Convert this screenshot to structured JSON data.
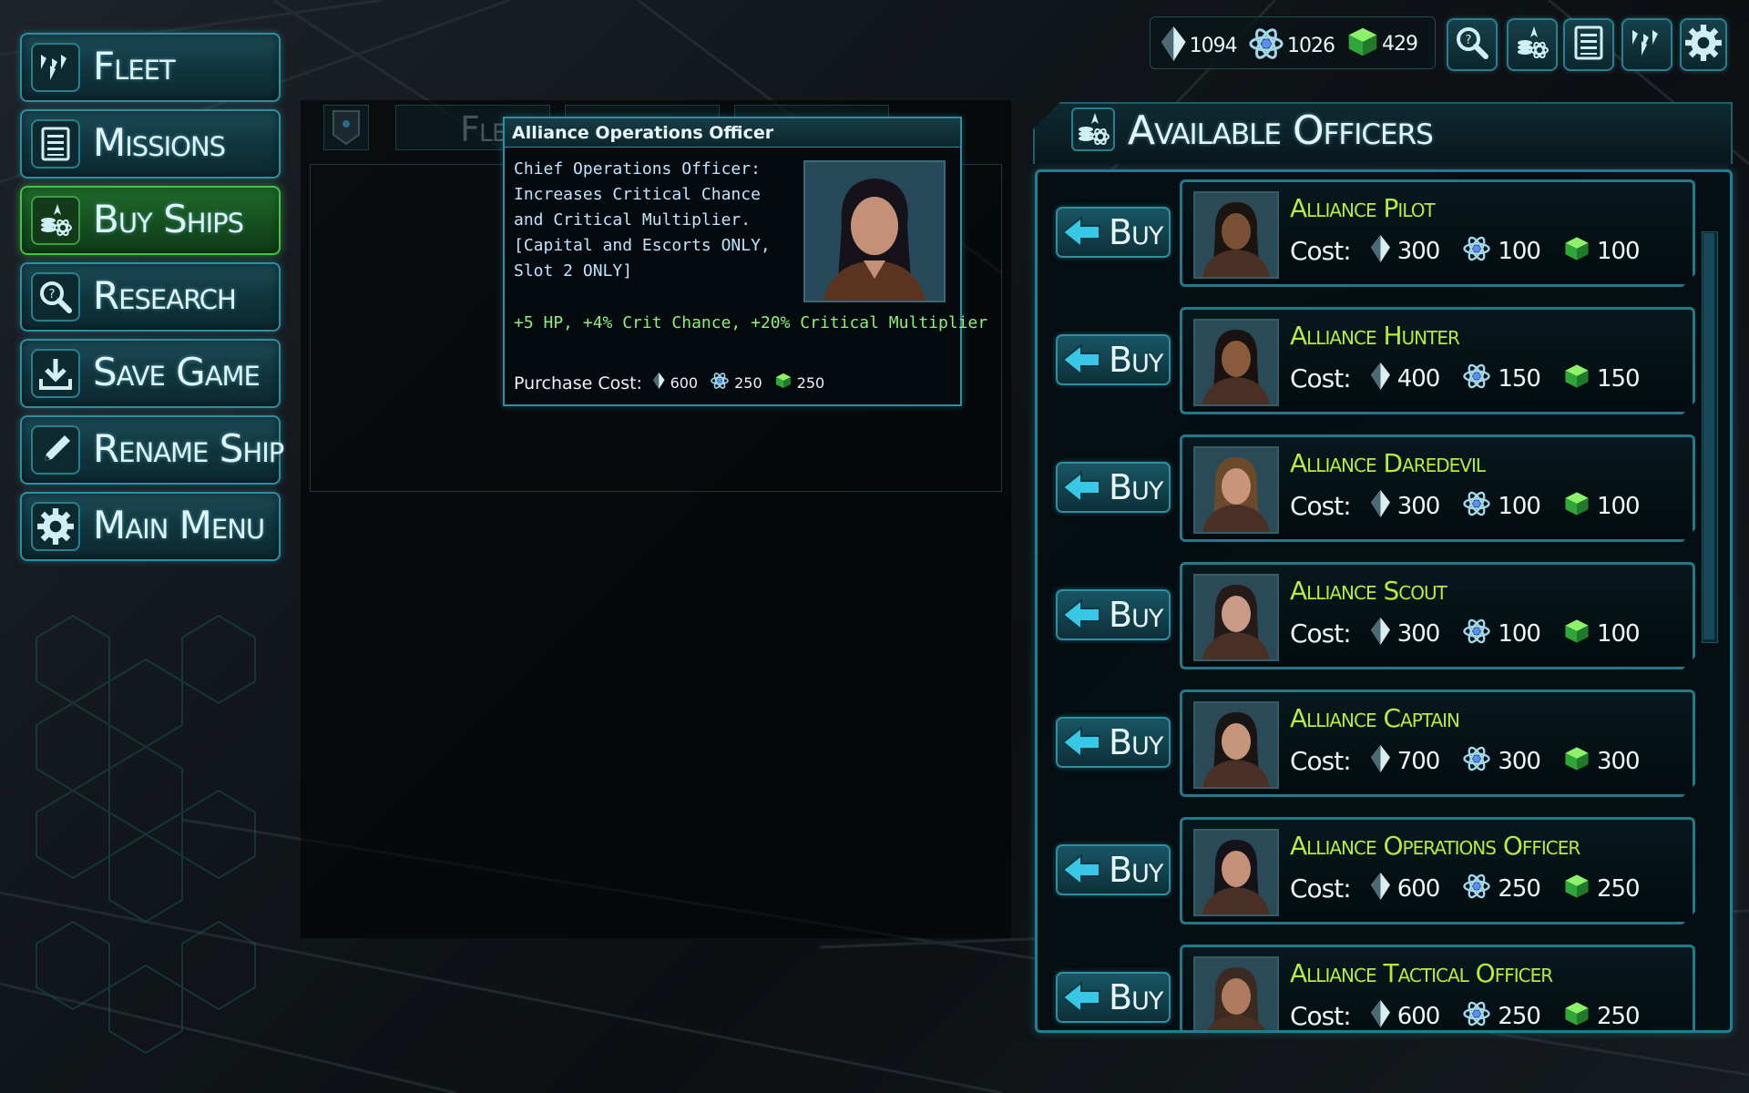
{
  "menu": [
    {
      "label": "Fleet",
      "icon": "fleet-icon",
      "active": false
    },
    {
      "label": "Missions",
      "icon": "list-icon",
      "active": false
    },
    {
      "label": "Buy Ships",
      "icon": "buy-ships-icon",
      "active": true
    },
    {
      "label": "Research",
      "icon": "research-icon",
      "active": false
    },
    {
      "label": "Save Game",
      "icon": "download-icon",
      "active": false
    },
    {
      "label": "Rename Ship",
      "icon": "pencil-icon",
      "active": false
    },
    {
      "label": "Main Menu",
      "icon": "gear-icon",
      "active": false
    }
  ],
  "ghost_tab_label": "Flee",
  "resources": {
    "crystal": "1094",
    "atom": "1026",
    "cube": "429"
  },
  "top_buttons": [
    "research-icon",
    "buy-ships-icon",
    "list-icon",
    "fleet-icon",
    "gear-icon"
  ],
  "tooltip": {
    "title": "Alliance Operations Officer",
    "description": "Chief Operations Officer: Increases Critical Chance and Critical Multiplier.  [Capital and Escorts ONLY, Slot 2 ONLY]",
    "bonus": "+5 HP, +4% Crit Chance, +20% Critical Multiplier",
    "cost_label": "Purchase Cost:",
    "cost": {
      "crystal": "600",
      "atom": "250",
      "cube": "250"
    }
  },
  "officers_panel": {
    "title": "Available Officers",
    "buy_label": "Buy",
    "cost_label": "Cost:",
    "officers": [
      {
        "name": "Alliance Pilot",
        "crystal": "300",
        "atom": "100",
        "cube": "100",
        "hair": "#1c1410",
        "skin": "#7a5036"
      },
      {
        "name": "Alliance Hunter",
        "crystal": "400",
        "atom": "150",
        "cube": "150",
        "hair": "#1a1210",
        "skin": "#8a5a3c"
      },
      {
        "name": "Alliance Daredevil",
        "crystal": "300",
        "atom": "100",
        "cube": "100",
        "hair": "#6a4a2a",
        "skin": "#c8957a"
      },
      {
        "name": "Alliance Scout",
        "crystal": "300",
        "atom": "100",
        "cube": "100",
        "hair": "#241a1a",
        "skin": "#c99a86"
      },
      {
        "name": "Alliance Captain",
        "crystal": "700",
        "atom": "300",
        "cube": "300",
        "hair": "#1a1414",
        "skin": "#c5957c"
      },
      {
        "name": "Alliance Operations Officer",
        "crystal": "600",
        "atom": "250",
        "cube": "250",
        "hair": "#15121a",
        "skin": "#c49078"
      },
      {
        "name": "Alliance Tactical Officer",
        "crystal": "600",
        "atom": "250",
        "cube": "250",
        "hair": "#3a2a22",
        "skin": "#b07a5e"
      }
    ]
  },
  "colors": {
    "accent": "#2c8fa2",
    "active_green": "#46c24a",
    "officer_name": "#b7ec3a",
    "bonus_text": "#8df07a"
  }
}
